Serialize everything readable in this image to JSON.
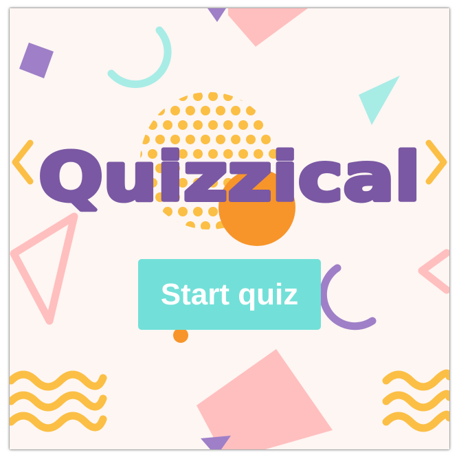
{
  "app": {
    "title": "Quizzical"
  },
  "start_button": {
    "label": "Start quiz"
  },
  "colors": {
    "background": "#fdf6f3",
    "title_purple": "#7a58a3",
    "accent_yellow": "#fbbf45",
    "accent_orange": "#f7952a",
    "accent_pink": "#ffbfbf",
    "accent_teal": "#72e0d8",
    "accent_purple_light": "#9f7fc7"
  },
  "decorations": [
    "circle-icon",
    "triangle-icon",
    "square-icon",
    "wave-icon",
    "arc-icon",
    "chevron-icon"
  ]
}
